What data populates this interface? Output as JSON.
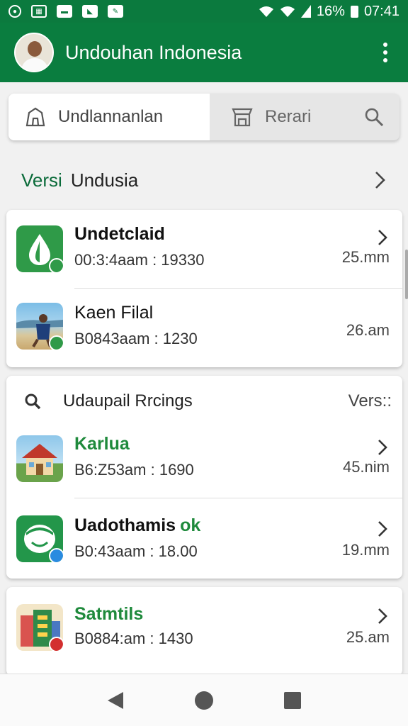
{
  "status_bar": {
    "icons": [
      "record-icon",
      "gallery-icon",
      "message-icon",
      "message-icon",
      "edit-icon"
    ],
    "battery_text": "16%",
    "time": "07:41"
  },
  "app_bar": {
    "title": "Undouhan Indonesia",
    "menu_icon": "more-vert-icon",
    "color": "#0a7d3f"
  },
  "tabs": [
    {
      "label": "Undlannanlan",
      "icon": "home-icon",
      "active": true
    },
    {
      "label": "Rerari",
      "icon": "store-icon",
      "active": false
    }
  ],
  "section": {
    "prefix": "Versi",
    "label": "Undusia"
  },
  "card1": {
    "items": [
      {
        "title": "Undetclaid",
        "subtitle": "00:3:4aam : 19330",
        "size": "25.mm",
        "icon": "droplet-icon"
      },
      {
        "title": "Kaen Filal",
        "subtitle": "B0843aam : 1230",
        "size": "26.am",
        "icon": "beach-photo"
      }
    ]
  },
  "card2": {
    "header_label": "Udaupail Rrcings",
    "header_right": "Vers::",
    "items": [
      {
        "title": "Karlua",
        "subtitle": "B6:Z53am : 1690",
        "size": "45.nim",
        "icon": "house-icon"
      },
      {
        "title": "Uadothamis",
        "title_extra": "ok",
        "subtitle": "B0:43aam : 18.00",
        "size": "19.mm",
        "icon": "chat-icon"
      }
    ]
  },
  "card3": {
    "items": [
      {
        "title": "Satmtils",
        "subtitle": "B0884:am : 1430",
        "size": "25.am",
        "icon": "building-icon"
      }
    ]
  },
  "nav": {
    "back": "back-icon",
    "home": "home-circle-icon",
    "recents": "recents-icon"
  },
  "colors": {
    "primary": "#0a7d3f",
    "accent_green": "#1f8a3c",
    "badge_blue": "#2a8be0",
    "badge_red": "#d32f2f"
  }
}
